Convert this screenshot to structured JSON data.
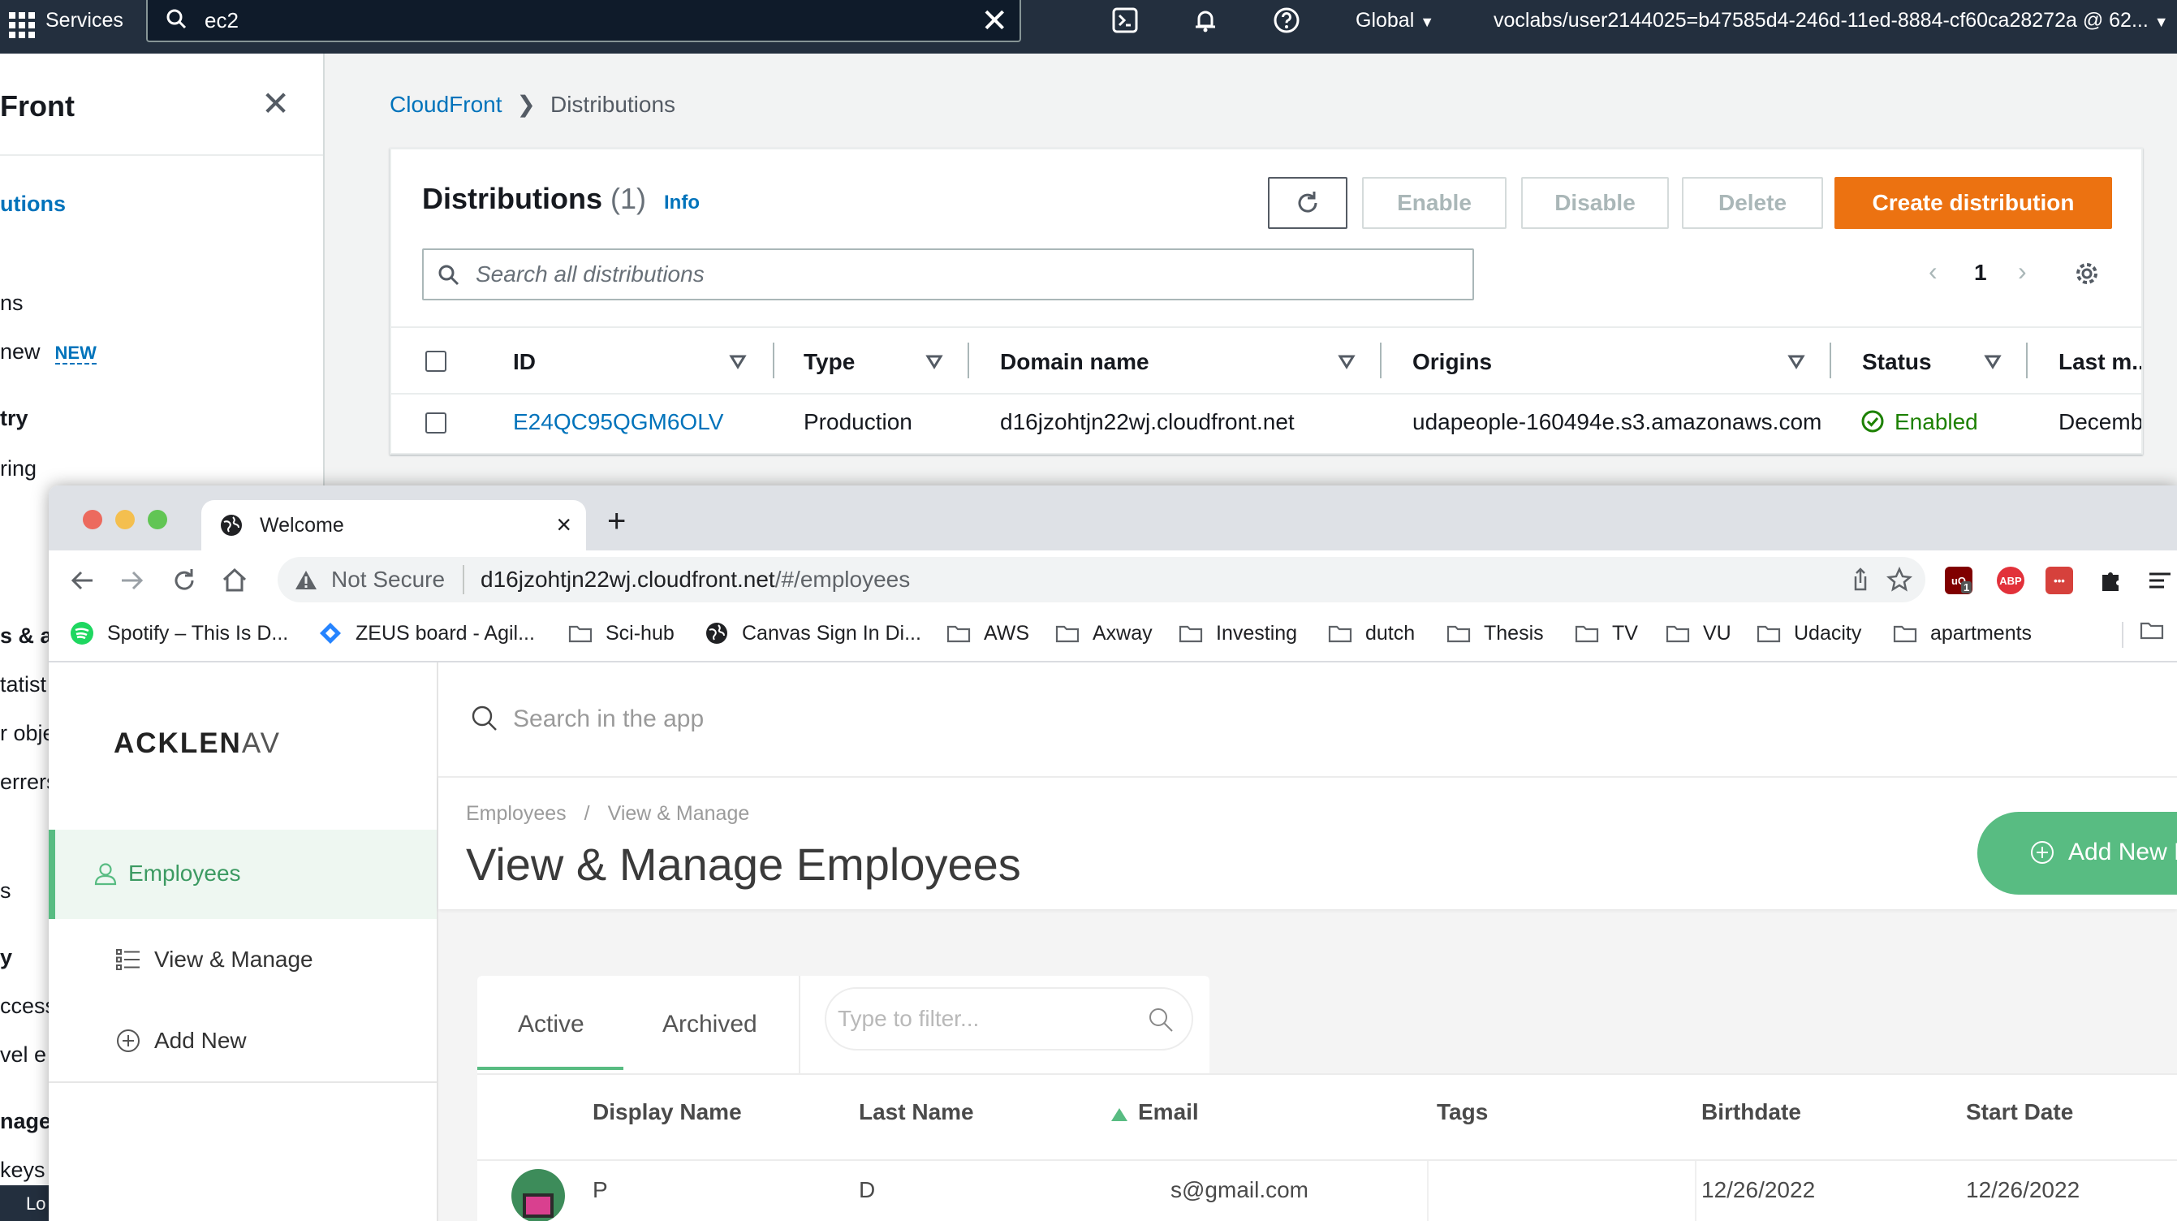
{
  "aws": {
    "services_label": "Services",
    "search_value": "ec2",
    "region": "Global",
    "account": "voclabs/user2144025=b47585d4-246d-11ed-8884-cf60ca28272a @ 62...",
    "nav": {
      "title": "Front",
      "items": [
        "utions",
        "ns",
        "new",
        "try",
        "ring",
        "s & ar",
        "tatist",
        "r obje",
        "errers",
        "s",
        "y",
        "ccess",
        "vel e",
        "nage",
        "keys"
      ],
      "new_badge": "NEW",
      "bottom": "Lo"
    },
    "breadcrumb": {
      "root": "CloudFront",
      "current": "Distributions"
    },
    "panel": {
      "title": "Distributions",
      "count": "(1)",
      "info": "Info",
      "buttons": {
        "enable": "Enable",
        "disable": "Disable",
        "delete": "Delete",
        "create": "Create distribution"
      },
      "search_placeholder": "Search all distributions",
      "page": "1",
      "columns": [
        "ID",
        "Type",
        "Domain name",
        "Origins",
        "Status",
        "Last m..."
      ],
      "rows": [
        {
          "id": "E24QC95QGM6OLV",
          "type": "Production",
          "domain": "d16jzohtjn22wj.cloudfront.net",
          "origins": "udapeople-160494e.s3.amazonaws.com",
          "status": "Enabled",
          "last_modified": "Decemb"
        }
      ]
    },
    "colors": {
      "topbar": "#232f3e",
      "primary": "#ec7211",
      "link": "#0073bb",
      "success": "#1d8102"
    }
  },
  "browser": {
    "tab_title": "Welcome",
    "not_secure": "Not Secure",
    "url_host": "d16jzohtjn22wj.cloudfront.net",
    "url_path": "/#/employees",
    "ext_badge": "1",
    "ext_abp": "ABP",
    "bookmarks": [
      "Spotify – This Is D...",
      "ZEUS board - Agil...",
      "Sci-hub",
      "Canvas Sign In Di...",
      "AWS",
      "Axway",
      "Investing",
      "dutch",
      "Thesis",
      "TV",
      "VU",
      "Udacity",
      "apartments"
    ]
  },
  "app": {
    "logo_main": "ACKLEN",
    "logo_tail": "AV",
    "search_placeholder": "Search in the app",
    "sidebar": [
      "Employees",
      "View & Manage",
      "Add New"
    ],
    "breadcrumb": [
      "Employees",
      "View & Manage"
    ],
    "page_title": "View & Manage Employees",
    "add_button": "Add New E",
    "tabs": [
      "Active",
      "Archived"
    ],
    "filter_placeholder": "Type to filter...",
    "columns": [
      "Display Name",
      "Last Name",
      "Email",
      "Tags",
      "Birthdate",
      "Start Date"
    ],
    "rows": [
      {
        "display_name": "P",
        "last_name": "D",
        "email": "s@gmail.com",
        "tags": "",
        "birthdate": "12/26/2022",
        "start_date": "12/26/2022"
      }
    ],
    "colors": {
      "accent": "#58bc82"
    }
  }
}
